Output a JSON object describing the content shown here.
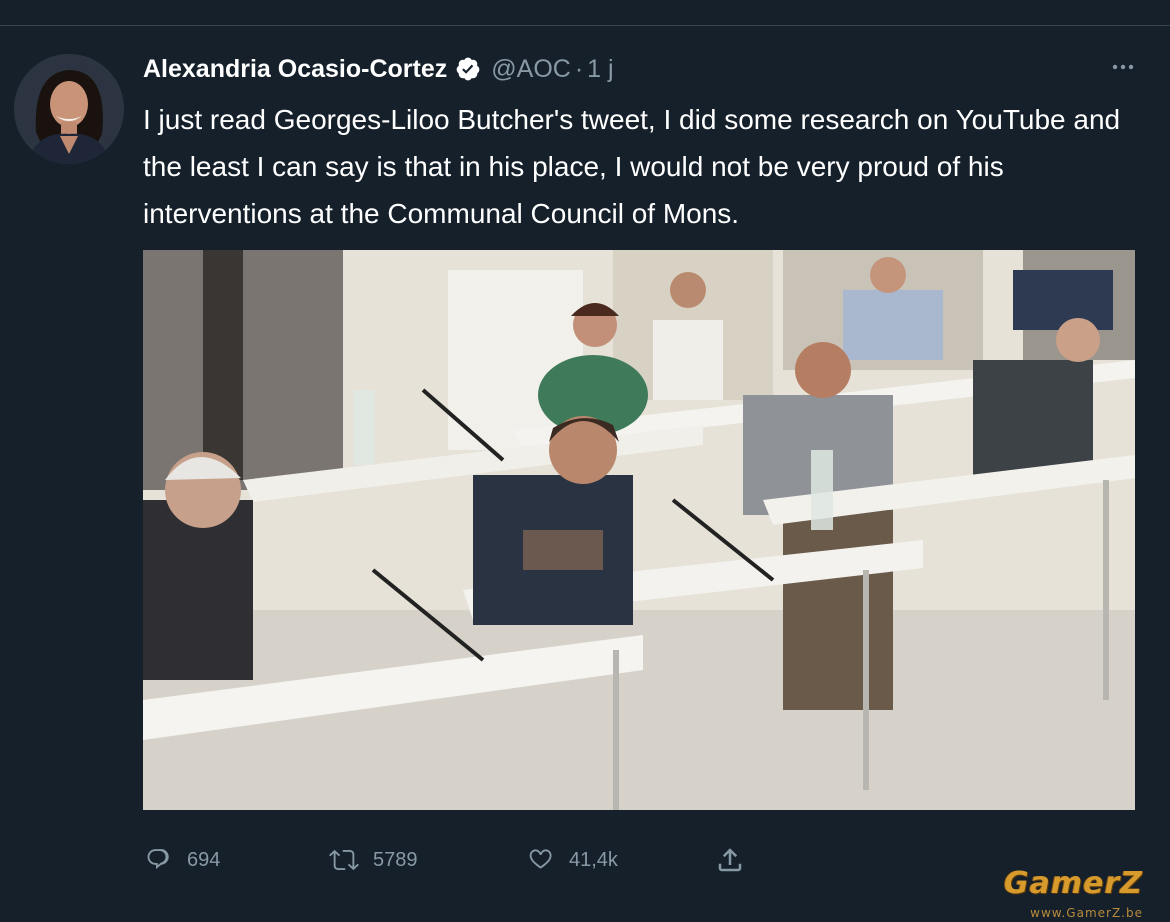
{
  "tweet": {
    "author_name": "Alexandria Ocasio-Cortez",
    "handle": "@AOC",
    "separator": "·",
    "time": "1 j",
    "more_icon": "more-horizontal-icon",
    "text": "I just read Georges-Liloo Butcher's tweet, I did some research on YouTube and the least I can say is that in his place, I would not be very proud of his interventions at the Communal Council of Mons.",
    "verified_color": "#ffffff"
  },
  "actions": {
    "reply": {
      "icon": "reply-icon",
      "count": "694"
    },
    "retweet": {
      "icon": "retweet-icon",
      "count": "5789"
    },
    "like": {
      "icon": "heart-icon",
      "count": "41,4k"
    },
    "share": {
      "icon": "share-icon"
    }
  },
  "colors": {
    "background": "#15202b",
    "text": "#ffffff",
    "muted": "#8899a6"
  },
  "watermark": {
    "logo": "GamerZ",
    "url": "www.GamerZ.be"
  }
}
